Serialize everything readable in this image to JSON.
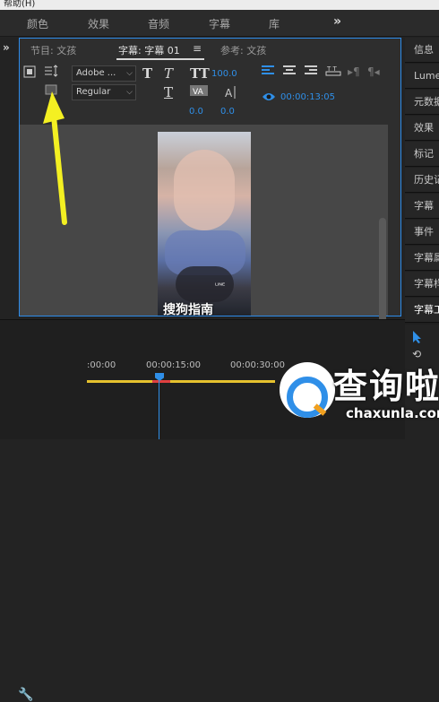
{
  "menubar": {
    "text": "帮助(H)"
  },
  "workspace_tabs": [
    "颜色",
    "效果",
    "音频",
    "字幕",
    "库"
  ],
  "workspace_more": "»",
  "panel": {
    "tabs": {
      "program": "节目: 文孩",
      "caption": "字幕: 字幕 01",
      "reference": "参考: 文孩"
    },
    "menu_icon": "≡"
  },
  "toolbar": {
    "font_family": "Adobe ...",
    "font_style": "Regular",
    "font_size": "100.0",
    "kerning": "0.0",
    "leading": "0.0",
    "timecode": "00:00:13:05"
  },
  "preview": {
    "caption_text": "搜狗指南",
    "stamp": "ᴸᴵᴺᴱ"
  },
  "right_panel": [
    "信息",
    "Lumetri",
    "元数据",
    "效果",
    "标记",
    "历史记录",
    "字幕",
    "事件",
    "字幕属性",
    "字幕样式",
    "字幕工具"
  ],
  "timeline": {
    "ticks": [
      ":00:00",
      "00:00:15:00",
      "00:00:30:00"
    ]
  },
  "watermark": {
    "text": "查询啦",
    "url": "chaxunla.com"
  },
  "colors": {
    "accent": "#2f8fe8",
    "annotation_arrow": "#f4f022"
  }
}
